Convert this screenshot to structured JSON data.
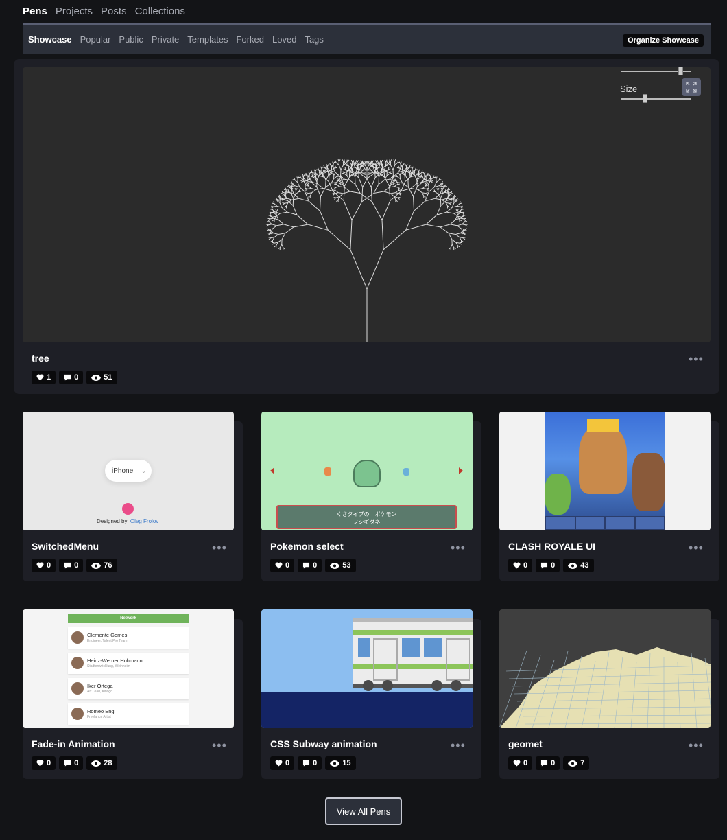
{
  "topnav": [
    {
      "label": "Pens",
      "active": true
    },
    {
      "label": "Projects"
    },
    {
      "label": "Posts"
    },
    {
      "label": "Collections"
    }
  ],
  "subnav": [
    "Showcase",
    "Popular",
    "Public",
    "Private",
    "Templates",
    "Forked",
    "Loved",
    "Tags"
  ],
  "organize_label": "Organize Showcase",
  "featured": {
    "title": "tree",
    "size_label": "Size",
    "hearts": "1",
    "comments": "0",
    "views": "51"
  },
  "cards": [
    {
      "title": "SwitchedMenu",
      "hearts": "0",
      "comments": "0",
      "views": "76",
      "preview": {
        "select_label": "iPhone",
        "credit_prefix": "Designed by: ",
        "credit_name": "Oleg Frolov"
      }
    },
    {
      "title": "Pokemon select",
      "hearts": "0",
      "comments": "0",
      "views": "53",
      "preview": {
        "line1": "くさタイプの　ポケモン",
        "line2": "フシギダネ"
      }
    },
    {
      "title": "CLASH ROYALE UI",
      "hearts": "0",
      "comments": "0",
      "views": "43"
    },
    {
      "title": "Fade-in Animation",
      "hearts": "0",
      "comments": "0",
      "views": "28",
      "preview": {
        "header": "Network",
        "people": [
          {
            "name": "Clemente Gomes",
            "sub": "Engineer, Talent Pro Team"
          },
          {
            "name": "Heinz-Werner Hohmann",
            "sub": "Stadtentwicklung, Weinheim"
          },
          {
            "name": "Iker Ortega",
            "sub": "Art Lead, Kitlogo"
          },
          {
            "name": "Romeo Eng",
            "sub": "Freelance Artist"
          }
        ]
      }
    },
    {
      "title": "CSS Subway animation",
      "hearts": "0",
      "comments": "0",
      "views": "15"
    },
    {
      "title": "geomet",
      "hearts": "0",
      "comments": "0",
      "views": "7"
    }
  ],
  "view_all_label": "View All Pens",
  "colors": {
    "bg": "#131417",
    "card": "#1e1f26",
    "subnav": "#2c303a",
    "accent": "#5a5f73"
  }
}
